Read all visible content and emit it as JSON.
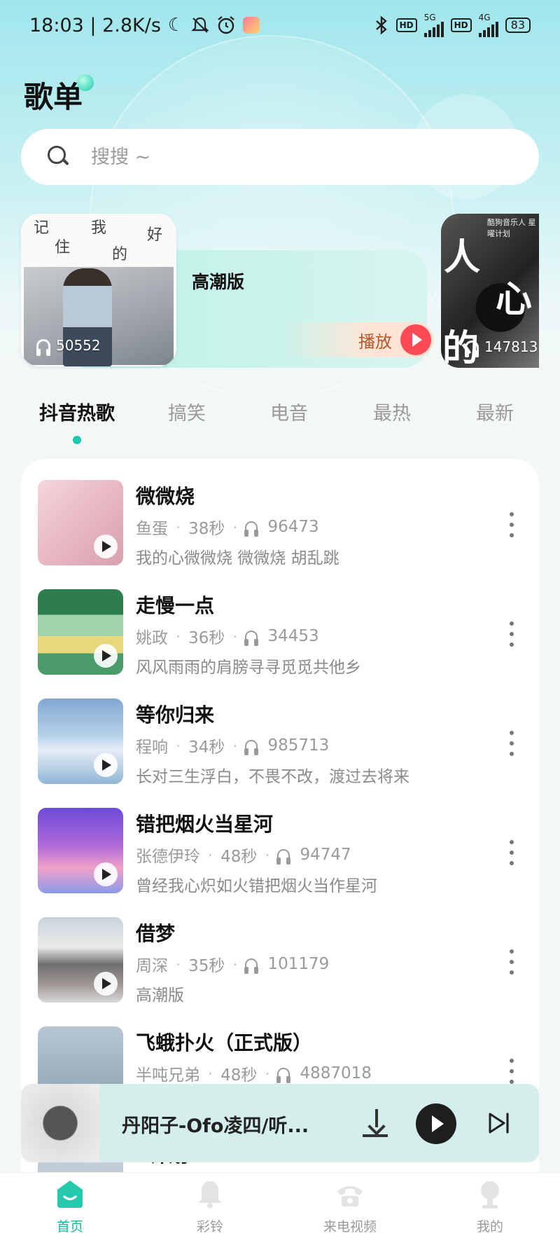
{
  "status_bar": {
    "time_speed": "18:03 | 2.8K/s",
    "network_5g": "5G",
    "network_4g": "4G",
    "hd1": "HD",
    "hd2": "HD",
    "battery": "83",
    "icons": [
      "moon-icon",
      "bell-off-icon",
      "alarm-icon",
      "bluetooth-icon"
    ]
  },
  "page": {
    "title": "歌单"
  },
  "search": {
    "placeholder": "搜搜 ~"
  },
  "featured": [
    {
      "name": "高潮版",
      "play_count": "50552",
      "play_label": "播放",
      "cover_text": [
        "记",
        "我",
        "好",
        "住",
        "的"
      ]
    },
    {
      "play_count": "147813",
      "cover_text": [
        "人",
        "心",
        "的"
      ],
      "cover_caption": "酷狗音乐人 星曜计划"
    }
  ],
  "tabs": [
    {
      "label": "抖音热歌",
      "active": true
    },
    {
      "label": "搞笑",
      "active": false
    },
    {
      "label": "电音",
      "active": false
    },
    {
      "label": "最热",
      "active": false
    },
    {
      "label": "最新",
      "active": false
    }
  ],
  "songs": [
    {
      "title": "微微烧",
      "artist": "鱼蛋",
      "duration": "38秒",
      "plays": "96473",
      "lyric": "我的心微微烧 微微烧 胡乱跳"
    },
    {
      "title": "走慢一点",
      "artist": "姚政",
      "duration": "36秒",
      "plays": "34453",
      "lyric": "风风雨雨的肩膀寻寻觅觅共他乡"
    },
    {
      "title": "等你归来",
      "artist": "程响",
      "duration": "34秒",
      "plays": "985713",
      "lyric": "长对三生浮白，不畏不改，渡过去将来"
    },
    {
      "title": "错把烟火当星河",
      "artist": "张德伊玲",
      "duration": "48秒",
      "plays": "94747",
      "lyric": "曾经我心炽如火错把烟火当作星河"
    },
    {
      "title": "借梦",
      "artist": "周深",
      "duration": "35秒",
      "plays": "101179",
      "lyric": "高潮版"
    },
    {
      "title": "飞蛾扑火（正式版）",
      "artist": "半吨兄弟",
      "duration": "48秒",
      "plays": "4887018",
      "lyric": ""
    },
    {
      "title": "a计划",
      "artist": "",
      "duration": "",
      "plays": "",
      "lyric": ""
    }
  ],
  "mini_player": {
    "title": "丹阳子-Ofo凌四/听..."
  },
  "bottom_nav": [
    {
      "label": "首页",
      "active": true
    },
    {
      "label": "彩铃",
      "active": false
    },
    {
      "label": "来电视频",
      "active": false
    },
    {
      "label": "我的",
      "active": false
    }
  ],
  "colors": {
    "accent": "#1ec9b0",
    "nav_active": "#14b79f",
    "play_red": "#ff4b55"
  }
}
